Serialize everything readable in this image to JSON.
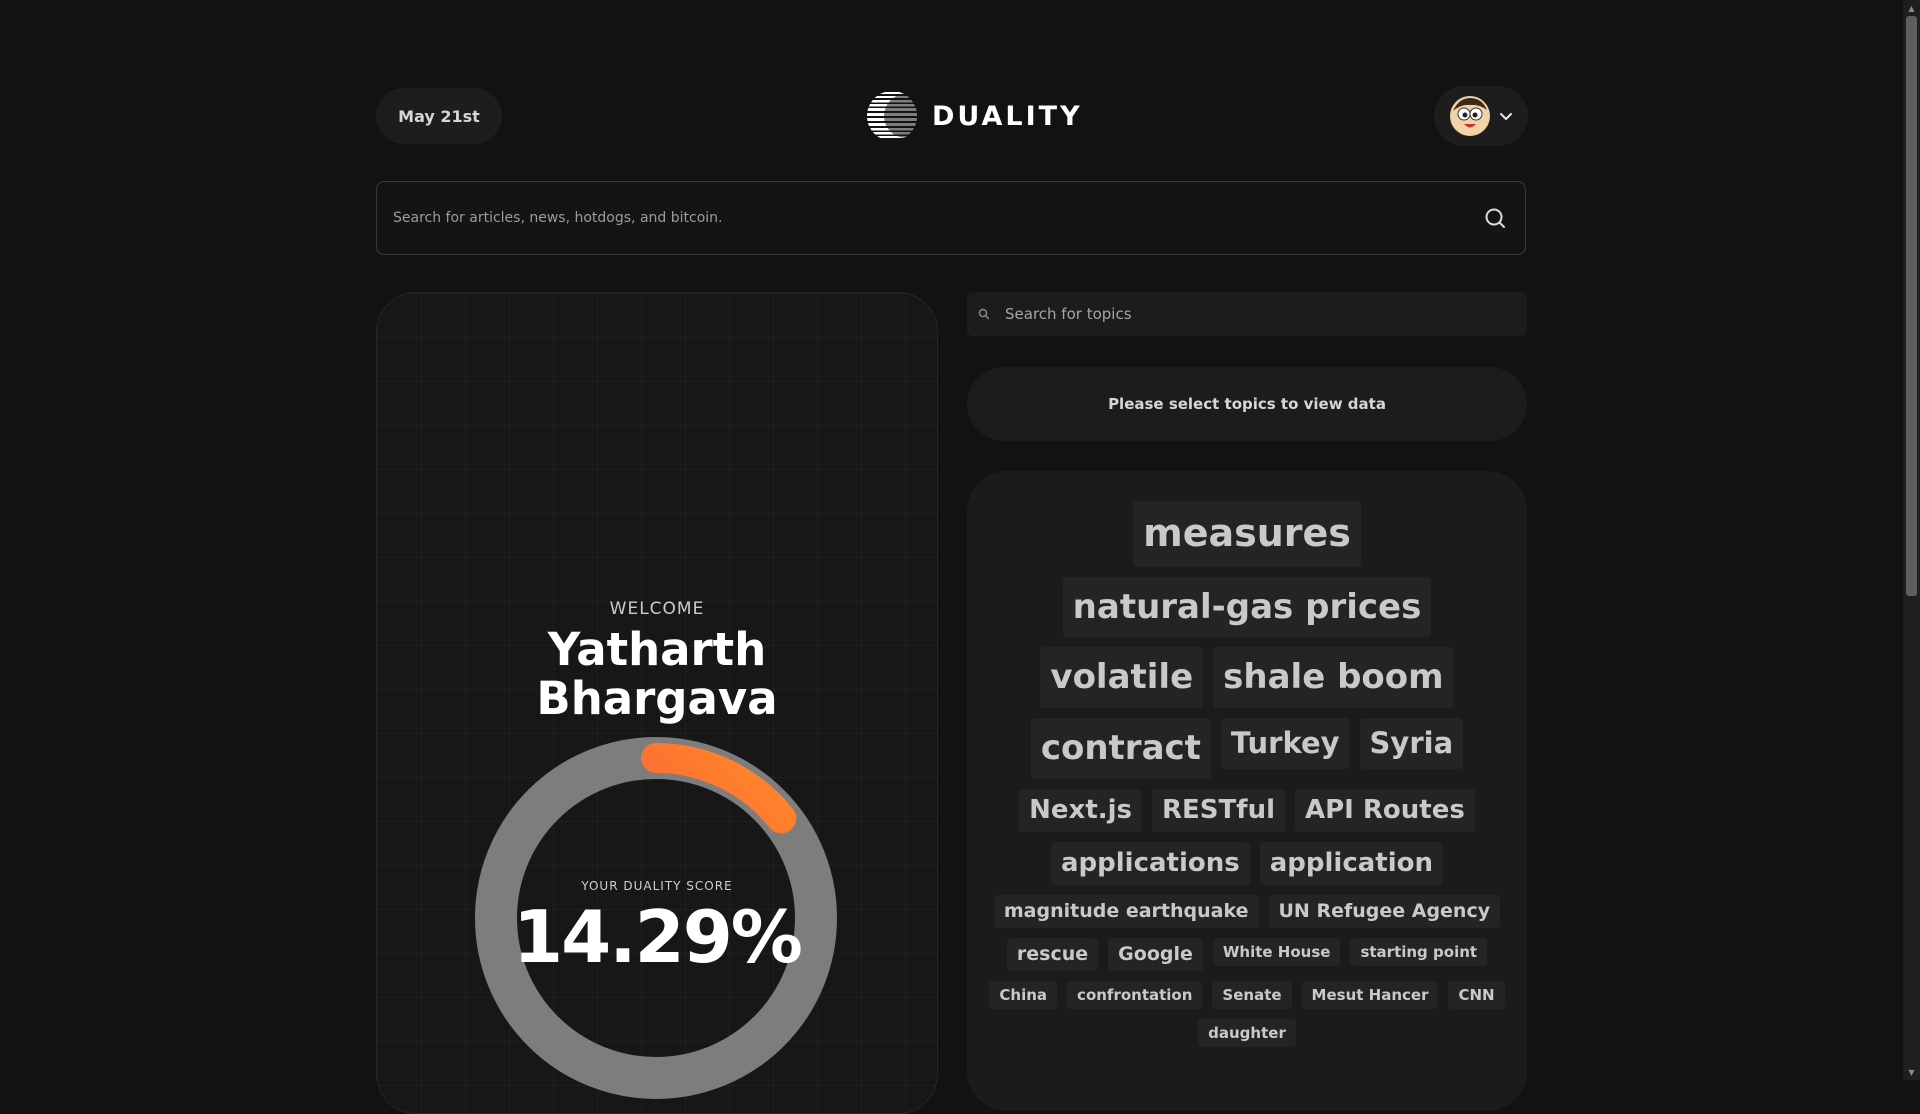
{
  "header": {
    "date_label": "May 21st",
    "brand": "DUALITY",
    "account_menu_icon": "chevron-down-icon",
    "avatar": "cartoon-face-avatar"
  },
  "search": {
    "placeholder": "Search for articles, news, hotdogs, and bitcoin.",
    "value": "",
    "icon": "search-icon"
  },
  "welcome": {
    "label": "WELCOME",
    "name_first": "Yatharth",
    "name_last": "Bhargava"
  },
  "score": {
    "label": "YOUR DUALITY SCORE",
    "display": "14.29%",
    "fraction": 0.1429,
    "track_color": "#7d7d7d",
    "gradient_start": "#f8264a",
    "gradient_end": "#ff8f28"
  },
  "topics": {
    "search_placeholder": "Search for topics",
    "search_value": "",
    "empty_message": "Please select topics to view data",
    "tags": [
      {
        "label": "measures",
        "size": 1
      },
      {
        "label": "natural-gas prices",
        "size": 2
      },
      {
        "label": "volatile",
        "size": 2
      },
      {
        "label": "shale boom",
        "size": 2
      },
      {
        "label": "contract",
        "size": 2
      },
      {
        "label": "Turkey",
        "size": 3
      },
      {
        "label": "Syria",
        "size": 3
      },
      {
        "label": "Next.js",
        "size": 4
      },
      {
        "label": "RESTful",
        "size": 4
      },
      {
        "label": "API Routes",
        "size": 4
      },
      {
        "label": "applications",
        "size": 4
      },
      {
        "label": "application",
        "size": 4
      },
      {
        "label": "magnitude earthquake",
        "size": 5
      },
      {
        "label": "UN Refugee Agency",
        "size": 5
      },
      {
        "label": "rescue",
        "size": 5
      },
      {
        "label": "Google",
        "size": 5
      },
      {
        "label": "White House",
        "size": 6
      },
      {
        "label": "starting point",
        "size": 6
      },
      {
        "label": "China",
        "size": 6
      },
      {
        "label": "confrontation",
        "size": 6
      },
      {
        "label": "Senate",
        "size": 6
      },
      {
        "label": "Mesut Hancer",
        "size": 6
      },
      {
        "label": "CNN",
        "size": 6
      },
      {
        "label": "daughter",
        "size": 6
      }
    ]
  }
}
